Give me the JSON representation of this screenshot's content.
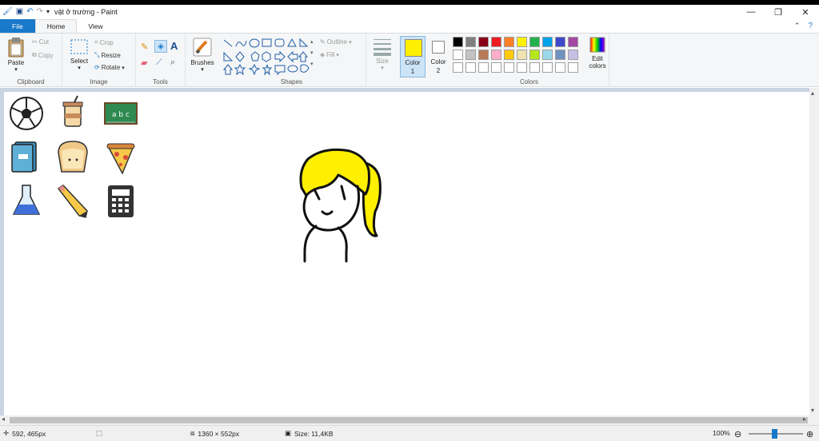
{
  "window": {
    "title": "vật ở trường - Paint",
    "minimize": "—",
    "maximize": "❐",
    "close": "✕"
  },
  "tabs": [
    "File",
    "Home",
    "View"
  ],
  "ribbon": {
    "clipboard": {
      "label": "Clipboard",
      "paste": "Paste",
      "cut": "Cut",
      "copy": "Copy"
    },
    "image": {
      "label": "Image",
      "select": "Select",
      "crop": "Crop",
      "resize": "Resize",
      "rotate": "Rotate"
    },
    "tools": {
      "label": "Tools"
    },
    "brushes": {
      "label": "Brushes"
    },
    "shapes": {
      "label": "Shapes",
      "outline": "Outline",
      "fill": "Fill"
    },
    "size": {
      "label": "Size"
    },
    "color1": {
      "label": "Color",
      "num": "1",
      "value": "#ffef00"
    },
    "color2": {
      "label": "Color",
      "num": "2",
      "value": "#ffffff"
    },
    "colors": {
      "label": "Colors",
      "edit_line1": "Edit",
      "edit_line2": "colors",
      "row1": [
        "#000000",
        "#7f7f7f",
        "#880015",
        "#ed1c24",
        "#ff7f27",
        "#fff200",
        "#22b14c",
        "#00a2e8",
        "#3f48cc",
        "#a349a4"
      ],
      "row2": [
        "#ffffff",
        "#c3c3c3",
        "#b97a57",
        "#ffaec9",
        "#ffc90e",
        "#efe4b0",
        "#b5e61d",
        "#99d9ea",
        "#7092be",
        "#c8bfe7"
      ],
      "row3": [
        "#ffffff",
        "#ffffff",
        "#ffffff",
        "#ffffff",
        "#ffffff",
        "#ffffff",
        "#ffffff",
        "#ffffff",
        "#ffffff",
        "#ffffff"
      ]
    }
  },
  "statusbar": {
    "cursor": "592, 465px",
    "dimensions": "1360 × 552px",
    "size": "Size: 11,4KB",
    "zoom": "100%"
  }
}
